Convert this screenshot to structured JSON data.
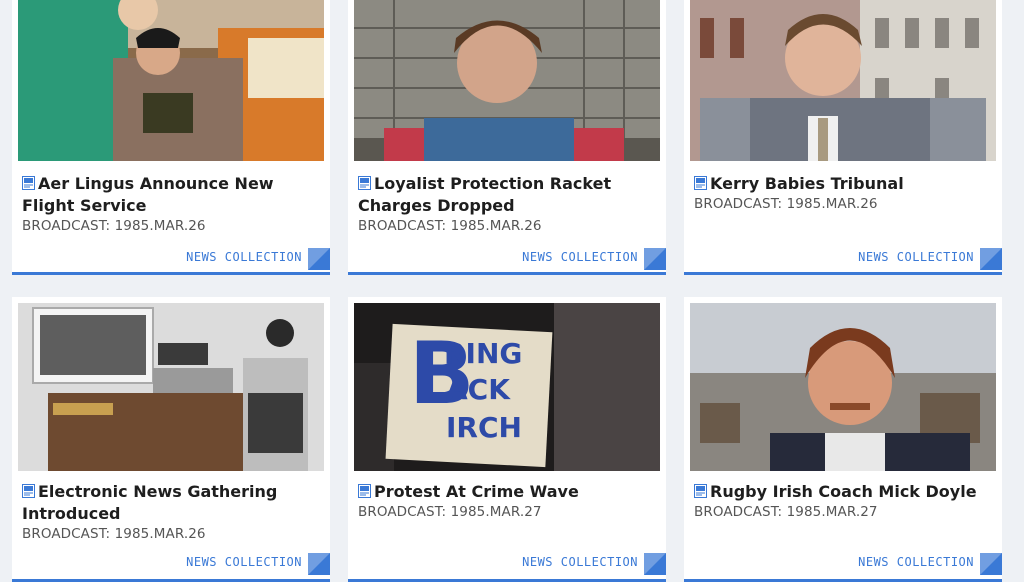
{
  "cards": [
    {
      "title": "Aer Lingus Announce New Flight Service",
      "broadcast": "BROADCAST: 1985.MAR.26",
      "collection": "NEWS COLLECTION"
    },
    {
      "title": "Loyalist Protection Racket Charges Dropped",
      "broadcast": "BROADCAST: 1985.MAR.26",
      "collection": "NEWS COLLECTION"
    },
    {
      "title": "Kerry Babies Tribunal",
      "broadcast": "BROADCAST: 1985.MAR.26",
      "collection": "NEWS COLLECTION"
    },
    {
      "title": "Electronic News Gathering Introduced",
      "broadcast": "BROADCAST: 1985.MAR.26",
      "collection": "NEWS COLLECTION"
    },
    {
      "title": "Protest At Crime Wave",
      "broadcast": "BROADCAST: 1985.MAR.27",
      "collection": "NEWS COLLECTION",
      "sign_lines": [
        "RING",
        "ACK",
        "IRCH"
      ],
      "sign_initials": "B"
    },
    {
      "title": "Rugby Irish Coach Mick Doyle",
      "broadcast": "BROADCAST: 1985.MAR.27",
      "collection": "NEWS COLLECTION"
    }
  ],
  "icons": {
    "card_icon": "document-icon",
    "corner": "corner-fold-icon"
  },
  "colors": {
    "accent": "#3a79d6",
    "page_bg": "#eef1f5",
    "card_bg": "#ffffff"
  }
}
